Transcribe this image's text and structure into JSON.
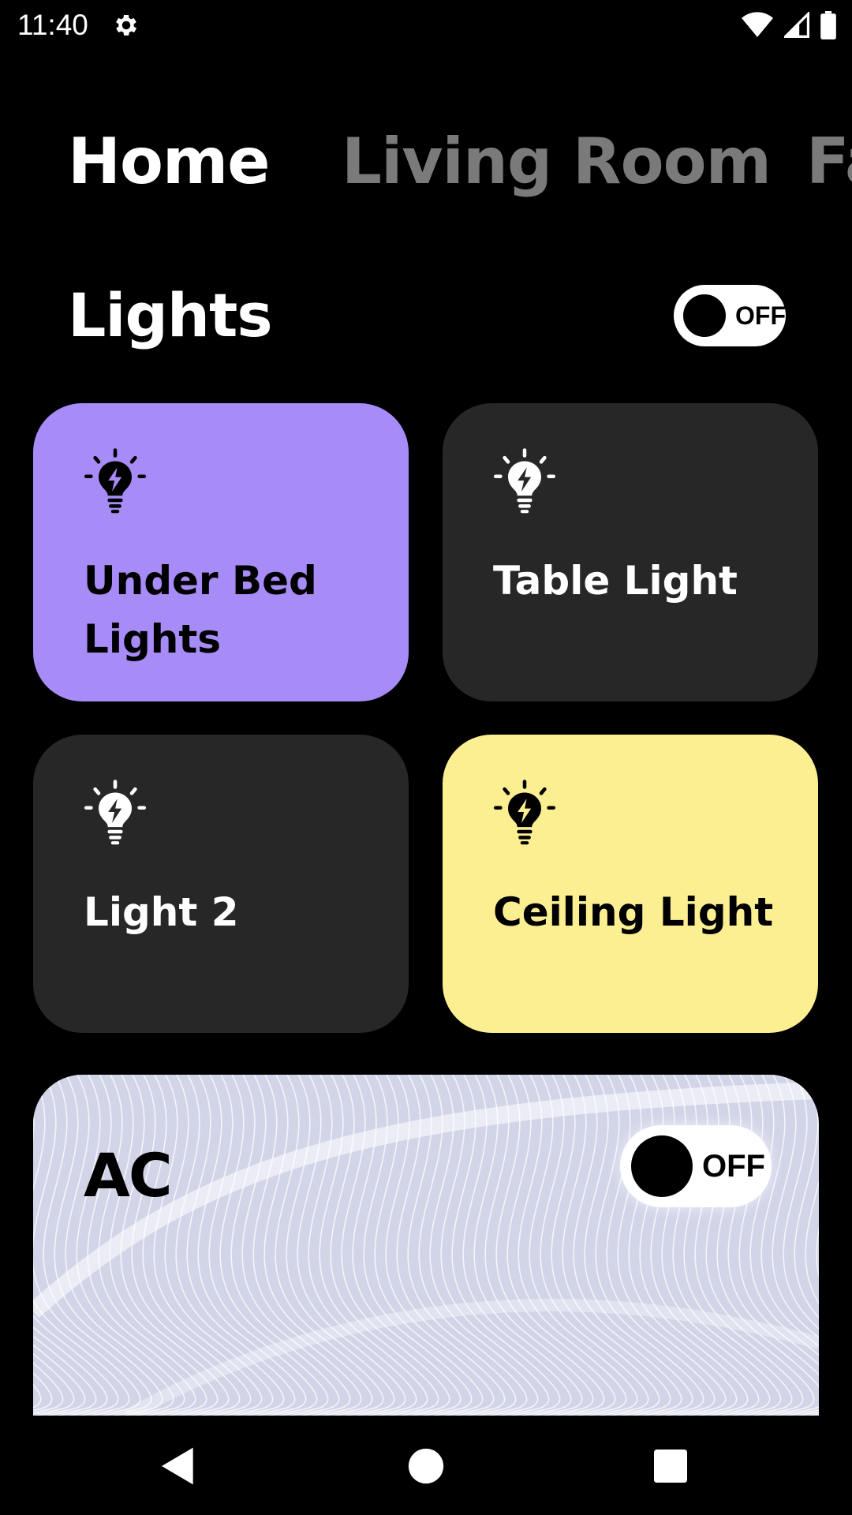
{
  "status_bar": {
    "time": "11:40",
    "icons": [
      "gear-icon",
      "wifi-icon",
      "signal-icon",
      "battery-icon"
    ]
  },
  "tabs": [
    {
      "label": "Home",
      "active": true
    },
    {
      "label": "Living Room",
      "active": false
    },
    {
      "label": "Fa",
      "active": false
    }
  ],
  "lights_section": {
    "title": "Lights",
    "toggle_label": "OFF"
  },
  "devices": [
    {
      "label": "Under Bed Lights",
      "icon": "bulb-icon",
      "color": "#a78bf7",
      "on": true
    },
    {
      "label": "Table Light",
      "icon": "bulb-icon",
      "color": "#272727",
      "on": false
    },
    {
      "label": "Light 2",
      "icon": "bulb-icon",
      "color": "#272727",
      "on": false
    },
    {
      "label": "Ceiling Light",
      "icon": "bulb-icon",
      "color": "#fcef91",
      "on": true
    }
  ],
  "ac_section": {
    "title": "AC",
    "toggle_label": "OFF"
  },
  "nav_bar": {
    "buttons": [
      "back-icon",
      "home-icon",
      "recents-icon"
    ]
  }
}
